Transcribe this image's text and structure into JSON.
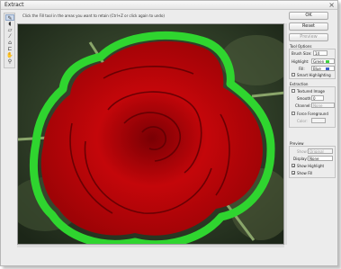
{
  "window": {
    "title": "Extract"
  },
  "instructions": "Click the Fill tool in the areas you want to retain (Ctrl+Z or click again to undo)",
  "toolbar": {
    "tools": [
      {
        "name": "edge-highlighter-tool",
        "glyph": "✎"
      },
      {
        "name": "fill-tool",
        "glyph": "◖"
      },
      {
        "name": "eraser-tool",
        "glyph": "▱"
      },
      {
        "name": "eyedropper-tool",
        "glyph": "⁄"
      },
      {
        "name": "cleanup-tool",
        "glyph": "⌂"
      },
      {
        "name": "edge-touchup-tool",
        "glyph": "⊏"
      },
      {
        "name": "hand-tool",
        "glyph": "✋"
      },
      {
        "name": "zoom-tool",
        "glyph": "⚲"
      }
    ]
  },
  "panel": {
    "ok_label": "OK",
    "reset_label": "Reset",
    "preview_label": "Preview",
    "tool_options": {
      "heading": "Tool Options",
      "brush_size_label": "Brush Size:",
      "brush_size_value": "14",
      "highlight_label": "Highlight:",
      "highlight_value": "Green",
      "fill_label": "Fill:",
      "fill_value": "Blue",
      "smart_highlighting_label": "Smart Highlighting",
      "highlight_color": "#3fd23f",
      "fill_color": "#3a5ec8"
    },
    "extraction": {
      "heading": "Extraction",
      "textured_image_label": "Textured Image",
      "smooth_label": "Smooth:",
      "smooth_value": "0",
      "channel_label": "Channel:",
      "channel_value": "None",
      "force_foreground_label": "Force Foreground",
      "color_label": "Color:"
    },
    "preview_section": {
      "heading": "Preview",
      "show_label": "Show:",
      "show_value": "Original",
      "display_label": "Display:",
      "display_value": "None",
      "show_highlight_label": "Show Highlight",
      "show_fill_label": "Show Fill"
    }
  },
  "image": {
    "subject": "red-rose",
    "rose_color": "#c8070a",
    "background_color": "#2d3b26",
    "highlight_stroke_color": "#2fd52f"
  }
}
